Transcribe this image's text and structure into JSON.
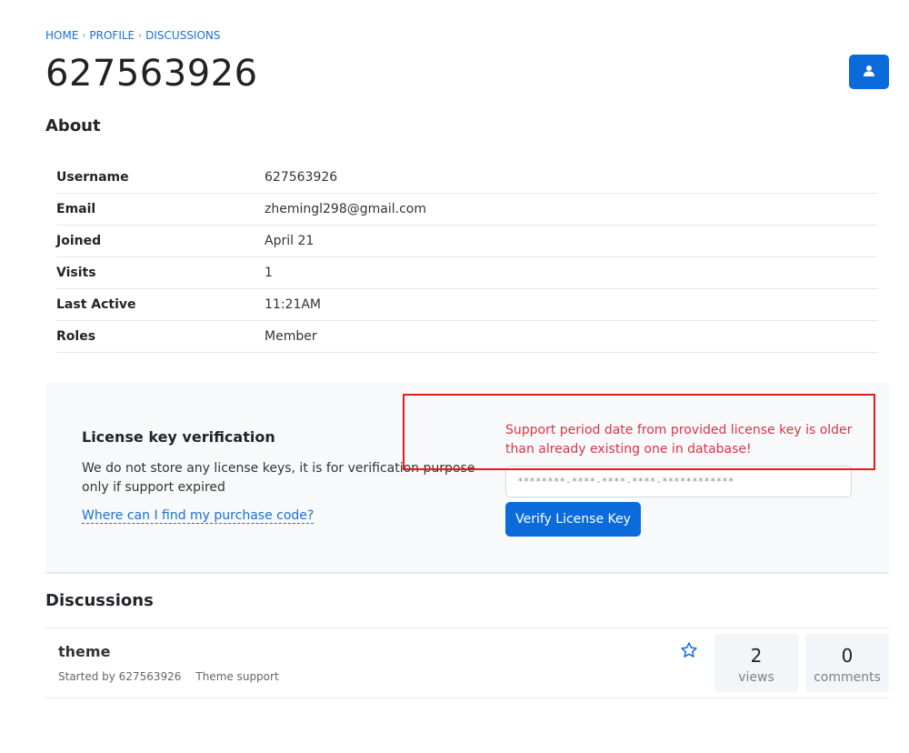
{
  "breadcrumb": [
    "HOME",
    "PROFILE",
    "DISCUSSIONS"
  ],
  "page_title": "627563926",
  "about": {
    "heading": "About",
    "rows": [
      {
        "label": "Username",
        "value": "627563926"
      },
      {
        "label": "Email",
        "value": "zhemingl298@gmail.com"
      },
      {
        "label": "Joined",
        "value": "April 21"
      },
      {
        "label": "Visits",
        "value": "1"
      },
      {
        "label": "Last Active",
        "value": "11:21AM"
      },
      {
        "label": "Roles",
        "value": "Member"
      }
    ]
  },
  "license": {
    "title": "License key verification",
    "description": "We do not store any license keys, it is for verification purpose only if support expired",
    "help_link": "Where can I find my purchase code?",
    "error": "Support period date from provided license key is older than already existing one in database!",
    "input_placeholder": "********-****-****-****-************",
    "verify_label": "Verify License Key"
  },
  "discussions": {
    "heading": "Discussions",
    "items": [
      {
        "title": "theme",
        "started_by": "Started by 627563926",
        "category": "Theme support",
        "views": "2",
        "views_label": "views",
        "comments": "0",
        "comments_label": "comments"
      }
    ]
  },
  "colors": {
    "accent": "#0b6bdb",
    "error": "#dc3545",
    "highlight": "#e41b1b"
  },
  "icons": {
    "user_button": "user-icon",
    "star": "star-outline-icon"
  }
}
